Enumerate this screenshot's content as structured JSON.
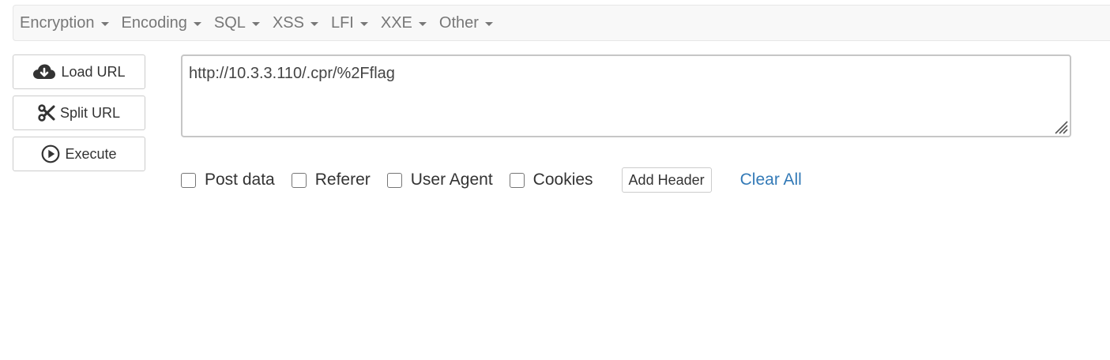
{
  "menu": {
    "items": [
      {
        "label": "Encryption"
      },
      {
        "label": "Encoding"
      },
      {
        "label": "SQL"
      },
      {
        "label": "XSS"
      },
      {
        "label": "LFI"
      },
      {
        "label": "XXE"
      },
      {
        "label": "Other"
      }
    ]
  },
  "actions": {
    "load_url": "Load URL",
    "split_url": "Split URL",
    "execute": "Execute"
  },
  "url_input": {
    "value": "http://10.3.3.110/.cpr/%2Fflag"
  },
  "options": {
    "post_data": "Post data",
    "referer": "Referer",
    "user_agent": "User Agent",
    "cookies": "Cookies",
    "add_header": "Add Header",
    "clear_all": "Clear All"
  },
  "colors": {
    "menu_text": "#777777",
    "link": "#337ab7",
    "menubar_bg": "#f8f8f8"
  },
  "icons": {
    "load_url": "cloud-download-icon",
    "split_url": "scissors-icon",
    "execute": "play-circle-icon"
  }
}
